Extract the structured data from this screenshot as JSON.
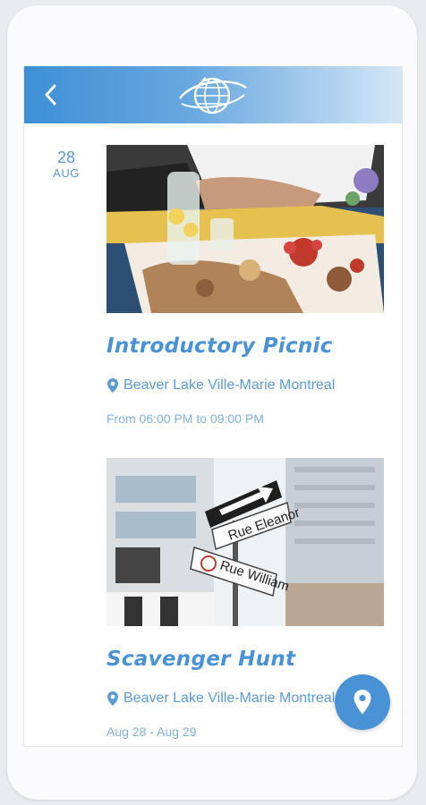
{
  "header": {
    "back_icon": "chevron-left-icon",
    "logo_icon": "globe-logo-icon"
  },
  "date": {
    "day": "28",
    "month": "AUG"
  },
  "events": [
    {
      "title": "Introductory Picnic",
      "location": "Beaver Lake Ville-Marie Montreal",
      "time": "From 06:00 PM to 09:00 PM",
      "image": "picnic-photo"
    },
    {
      "title": "Scavenger Hunt",
      "location": "Beaver Lake Ville-Marie Montreal",
      "time": "Aug 28 - Aug 29",
      "image": "street-sign-photo",
      "sign_text_1": "Rue Eleanor",
      "sign_text_2": "Rue William"
    }
  ],
  "fab": {
    "icon": "map-pin-icon"
  },
  "colors": {
    "accent": "#4a92d6",
    "header_start": "#3d8fd6",
    "header_end": "#d4e7f7"
  }
}
